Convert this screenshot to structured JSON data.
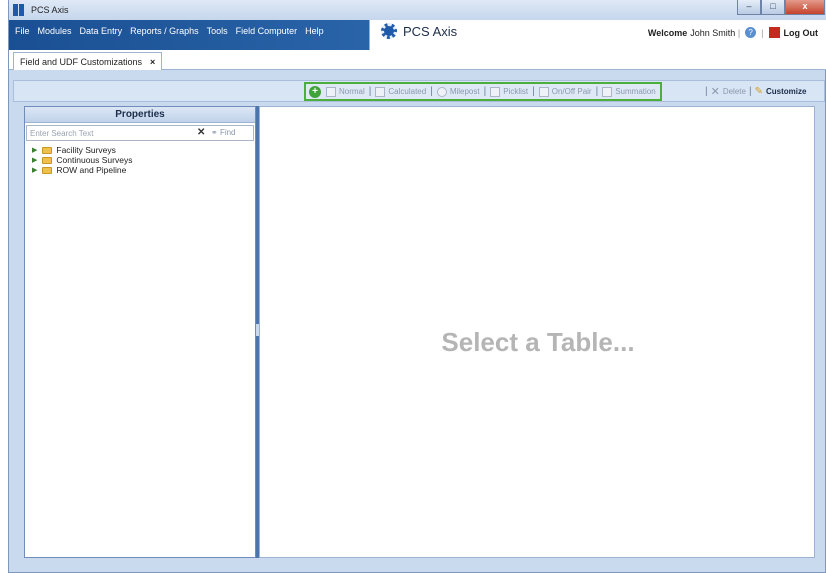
{
  "window": {
    "title": "PCS Axis",
    "controls": {
      "minimize": "–",
      "maximize": "□",
      "close": "x"
    }
  },
  "menu": {
    "items": [
      "File",
      "Modules",
      "Data Entry",
      "Reports / Graphs",
      "Tools",
      "Field Computer",
      "Help"
    ]
  },
  "brand": {
    "name": "PCS Axis"
  },
  "user": {
    "welcome": "Welcome",
    "name": "John Smith",
    "logout": "Log Out"
  },
  "tabs": [
    {
      "label": "Field and UDF Customizations",
      "close": "×"
    }
  ],
  "toolbar": {
    "items": [
      "Normal",
      "Calculated",
      "Milepost",
      "Picklist",
      "On/Off Pair",
      "Summation"
    ],
    "delete": "Delete",
    "customize": "Customize",
    "colors": {
      "group_border": "#4caf3c"
    }
  },
  "properties": {
    "title": "Properties",
    "search_placeholder": "Enter Search Text",
    "find_label": "Find",
    "tree": [
      "Facility Surveys",
      "Continuous Surveys",
      "ROW and Pipeline"
    ]
  },
  "main": {
    "placeholder": "Select a Table..."
  }
}
